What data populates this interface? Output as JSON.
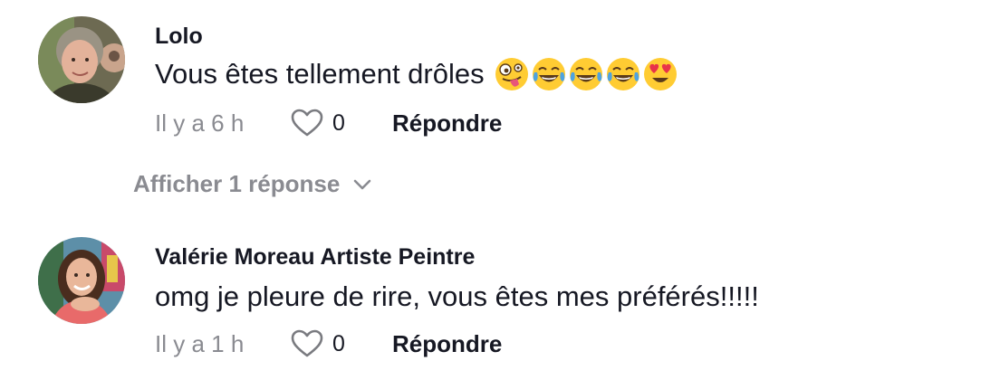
{
  "comments": [
    {
      "username": "Lolo",
      "text": "Vous êtes tellement drôles",
      "emojis": [
        "zany-face",
        "tears-of-joy",
        "tears-of-joy",
        "tears-of-joy",
        "heart-eyes"
      ],
      "time": "Il y a 6 h",
      "likes": "0",
      "reply_label": "Répondre"
    },
    {
      "username": "Valérie Moreau Artiste Peintre",
      "text": "omg je pleure de rire, vous êtes mes préférés!!!!!",
      "time": "Il y a 1 h",
      "likes": "0",
      "reply_label": "Répondre"
    }
  ],
  "view_replies": {
    "label": "Afficher 1 réponse",
    "icon": "chevron-down-icon"
  },
  "colors": {
    "text": "#161823",
    "muted": "#8a8b91",
    "emoji_yellow": "#FFCC33",
    "tear_blue": "#4FA3E0"
  }
}
